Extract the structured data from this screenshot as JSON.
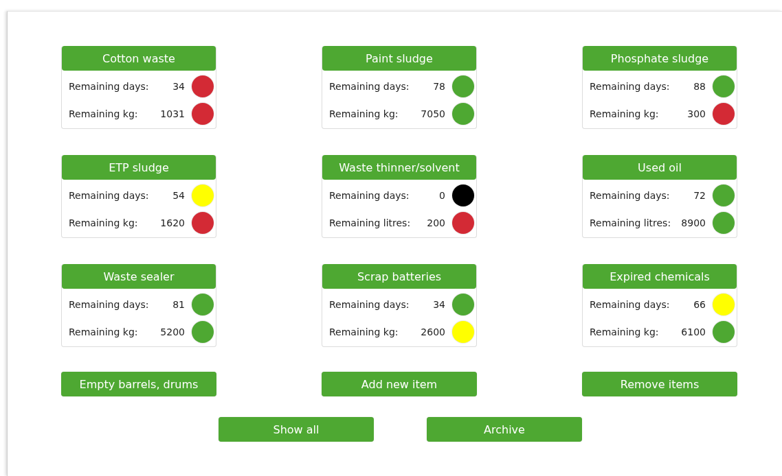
{
  "cards": [
    {
      "title": "Cotton waste",
      "rows": [
        {
          "label": "Remaining days:",
          "value": "34",
          "color": "#d32a35"
        },
        {
          "label": "Remaining kg:",
          "value": "1031",
          "color": "#d32a35"
        }
      ]
    },
    {
      "title": "Paint sludge",
      "rows": [
        {
          "label": "Remaining days:",
          "value": "78",
          "color": "#4ea832"
        },
        {
          "label": "Remaining kg:",
          "value": "7050",
          "color": "#4ea832"
        }
      ]
    },
    {
      "title": "Phosphate sludge",
      "rows": [
        {
          "label": "Remaining days:",
          "value": "88",
          "color": "#4ea832"
        },
        {
          "label": "Remaining kg:",
          "value": "300",
          "color": "#d32a35"
        }
      ]
    },
    {
      "title": "ETP sludge",
      "rows": [
        {
          "label": "Remaining days:",
          "value": "54",
          "color": "#ffff00"
        },
        {
          "label": "Remaining kg:",
          "value": "1620",
          "color": "#d32a35"
        }
      ]
    },
    {
      "title": "Waste thinner/solvent",
      "rows": [
        {
          "label": "Remaining days:",
          "value": "0",
          "color": "#000000"
        },
        {
          "label": "Remaining litres:",
          "value": "200",
          "color": "#d32a35"
        }
      ]
    },
    {
      "title": "Used oil",
      "rows": [
        {
          "label": "Remaining days:",
          "value": "72",
          "color": "#4ea832"
        },
        {
          "label": "Remaining litres:",
          "value": "8900",
          "color": "#4ea832"
        }
      ]
    },
    {
      "title": "Waste sealer",
      "rows": [
        {
          "label": "Remaining days:",
          "value": "81",
          "color": "#4ea832"
        },
        {
          "label": "Remaining kg:",
          "value": "5200",
          "color": "#4ea832"
        }
      ]
    },
    {
      "title": "Scrap batteries",
      "rows": [
        {
          "label": "Remaining days:",
          "value": "34",
          "color": "#4ea832"
        },
        {
          "label": "Remaining kg:",
          "value": "2600",
          "color": "#ffff00"
        }
      ]
    },
    {
      "title": "Expired chemicals",
      "rows": [
        {
          "label": "Remaining days:",
          "value": "66",
          "color": "#ffff00"
        },
        {
          "label": "Remaining kg:",
          "value": "6100",
          "color": "#4ea832"
        }
      ]
    }
  ],
  "item_buttons": [
    "Empty barrels, drums",
    "Add new item",
    "Remove items"
  ],
  "bottom_buttons": [
    "Show all",
    "Archive"
  ]
}
